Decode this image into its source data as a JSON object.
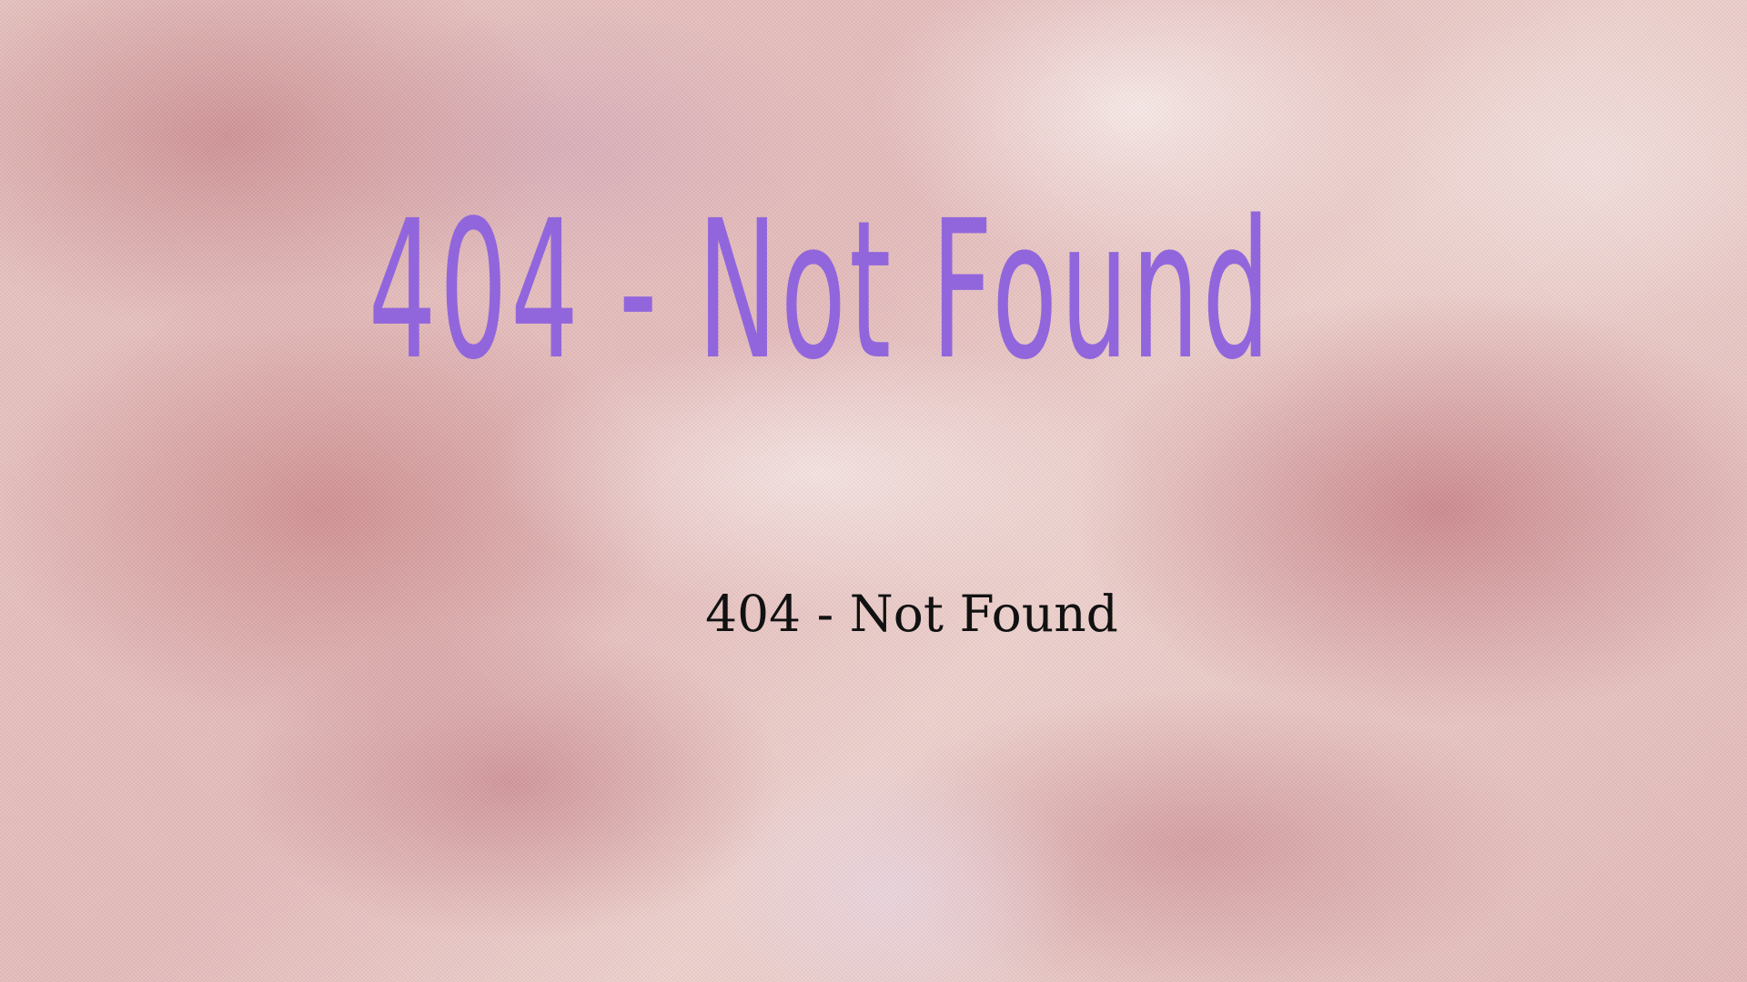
{
  "page": {
    "headline": "404 - Not Found",
    "message": "404 - Not Found"
  },
  "colors": {
    "headline": "#9166dc",
    "message": "#111111",
    "background": "#e8c3c3"
  }
}
